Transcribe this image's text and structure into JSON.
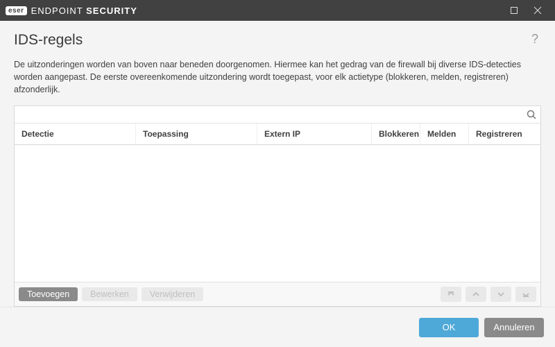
{
  "brand": {
    "badge": "eser",
    "name_light": "ENDPOINT ",
    "name_bold": "SECURITY"
  },
  "page": {
    "title": "IDS-regels",
    "description": "De uitzonderingen worden van boven naar beneden doorgenomen. Hiermee kan het gedrag van de firewall bij diverse IDS-detecties worden aangepast. De eerste overeenkomende uitzondering wordt toegepast, voor elk actietype (blokkeren, melden, registreren) afzonderlijk."
  },
  "search": {
    "placeholder": ""
  },
  "columns": {
    "detection": "Detectie",
    "application": "Toepassing",
    "extern_ip": "Extern IP",
    "block": "Blokkeren",
    "notify": "Melden",
    "log": "Registreren"
  },
  "rows": [],
  "toolbar": {
    "add": "Toevoegen",
    "edit": "Bewerken",
    "delete": "Verwijderen"
  },
  "footer": {
    "ok": "OK",
    "cancel": "Annuleren"
  }
}
